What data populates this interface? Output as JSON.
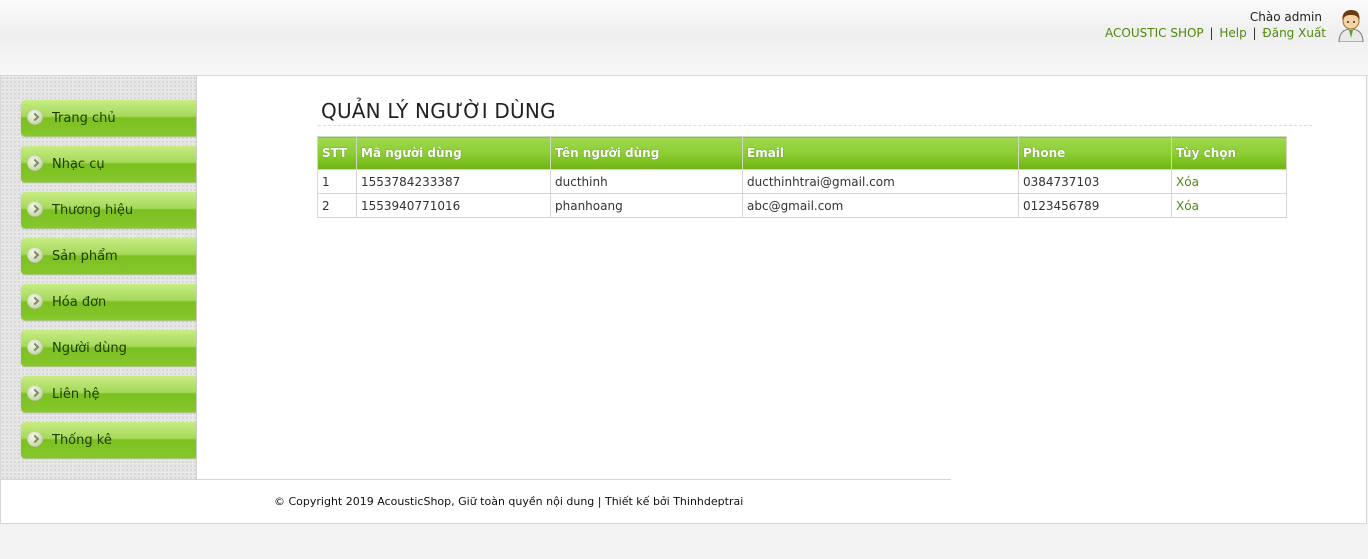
{
  "header": {
    "greeting": "Chào admin",
    "links": [
      "ACOUSTIC SHOP",
      "Help",
      "Đăng Xuất"
    ],
    "separator": "|"
  },
  "sidebar": {
    "items": [
      {
        "label": "Trang chủ"
      },
      {
        "label": "Nhạc cụ"
      },
      {
        "label": "Thương hiệu"
      },
      {
        "label": "Sản phẩm"
      },
      {
        "label": "Hóa đơn"
      },
      {
        "label": "Người dùng"
      },
      {
        "label": "Liên hệ"
      },
      {
        "label": "Thống kê"
      }
    ]
  },
  "main": {
    "title": "QUẢN LÝ NGƯỜI DÙNG",
    "table": {
      "headers": [
        "STT",
        "Mã người dùng",
        "Tên người dùng",
        "Email",
        "Phone",
        "Tùy chọn"
      ],
      "rows": [
        {
          "stt": "1",
          "id": "1553784233387",
          "name": "ducthinh",
          "email": "ducthinhtrai@gmail.com",
          "phone": "0384737103",
          "action": "Xóa"
        },
        {
          "stt": "2",
          "id": "1553940771016",
          "name": "phanhoang",
          "email": "abc@gmail.com",
          "phone": "0123456789",
          "action": "Xóa"
        }
      ]
    }
  },
  "footer": {
    "copyright": "© Copyright 2019 AcousticShop, Giữ toàn quyền nội dung | Thiết kế bởi Thinhdeptrai"
  },
  "colors": {
    "accent": "#7cc021",
    "link": "#4f8a10"
  },
  "icons": {
    "avatar": "user-avatar-icon",
    "nav_bullet": "chevron-right-circle-icon"
  }
}
